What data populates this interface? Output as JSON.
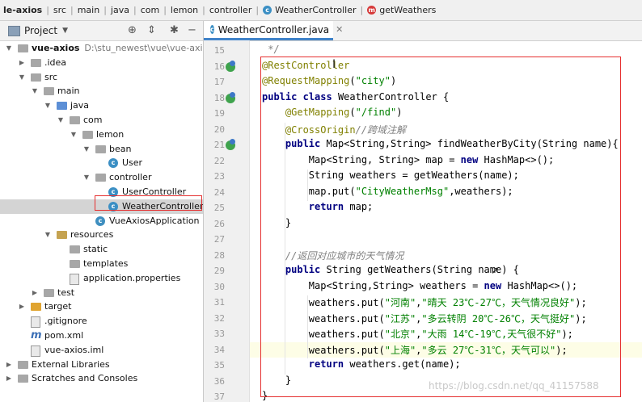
{
  "breadcrumb": [
    {
      "label": "le-axios",
      "icon": ""
    },
    {
      "label": "src",
      "icon": ""
    },
    {
      "label": "main",
      "icon": ""
    },
    {
      "label": "java",
      "icon": ""
    },
    {
      "label": "com",
      "icon": ""
    },
    {
      "label": "lemon",
      "icon": ""
    },
    {
      "label": "controller",
      "icon": ""
    },
    {
      "label": "WeatherController",
      "icon": "class-icon"
    },
    {
      "label": "getWeathers",
      "icon": "method-icon"
    }
  ],
  "project_panel": {
    "title": "Project",
    "tree": [
      {
        "label": "vue-axios",
        "extra": "D:\\stu_newest\\vue\\vue-axios",
        "depth": 0,
        "expanded": true,
        "icon": "module-folder-icon"
      },
      {
        "label": ".idea",
        "depth": 1,
        "expanded": false,
        "icon": "folder-icon"
      },
      {
        "label": "src",
        "depth": 1,
        "expanded": true,
        "icon": "folder-icon"
      },
      {
        "label": "main",
        "depth": 2,
        "expanded": true,
        "icon": "folder-icon"
      },
      {
        "label": "java",
        "depth": 3,
        "expanded": true,
        "icon": "source-folder-icon"
      },
      {
        "label": "com",
        "depth": 4,
        "expanded": true,
        "icon": "package-icon"
      },
      {
        "label": "lemon",
        "depth": 5,
        "expanded": true,
        "icon": "package-icon"
      },
      {
        "label": "bean",
        "depth": 6,
        "expanded": true,
        "icon": "package-icon"
      },
      {
        "label": "User",
        "depth": 7,
        "icon": "class-icon"
      },
      {
        "label": "controller",
        "depth": 6,
        "expanded": true,
        "icon": "package-icon"
      },
      {
        "label": "UserController",
        "depth": 7,
        "icon": "class-icon"
      },
      {
        "label": "WeatherController",
        "depth": 7,
        "icon": "class-icon",
        "selected": true
      },
      {
        "label": "VueAxiosApplication",
        "depth": 6,
        "icon": "spring-class-icon"
      },
      {
        "label": "resources",
        "depth": 3,
        "expanded": true,
        "icon": "resources-folder-icon"
      },
      {
        "label": "static",
        "depth": 4,
        "icon": "folder-icon"
      },
      {
        "label": "templates",
        "depth": 4,
        "icon": "folder-icon"
      },
      {
        "label": "application.properties",
        "depth": 4,
        "icon": "properties-file-icon"
      },
      {
        "label": "test",
        "depth": 2,
        "expanded": false,
        "icon": "folder-icon"
      },
      {
        "label": "target",
        "depth": 1,
        "expanded": false,
        "icon": "excluded-folder-icon"
      },
      {
        "label": ".gitignore",
        "depth": 1,
        "icon": "gitignore-file-icon"
      },
      {
        "label": "pom.xml",
        "depth": 1,
        "icon": "maven-file-icon"
      },
      {
        "label": "vue-axios.iml",
        "depth": 1,
        "icon": "iml-file-icon"
      },
      {
        "label": "External Libraries",
        "depth": 0,
        "expanded": false,
        "icon": "libraries-icon"
      },
      {
        "label": "Scratches and Consoles",
        "depth": 0,
        "expanded": false,
        "icon": "scratches-icon"
      }
    ]
  },
  "editor": {
    "tab_label": "WeatherController.java",
    "lines": [
      {
        "n": "15",
        "code": " */",
        "kind": "comment"
      },
      {
        "n": "16",
        "code": "@RestController",
        "kind": "annotation",
        "gutter": "bean"
      },
      {
        "n": "17",
        "code": "@RequestMapping(\"city\")",
        "kind": "annotation"
      },
      {
        "n": "18",
        "code": "public class WeatherController {",
        "kind": "code",
        "gutter": "web"
      },
      {
        "n": "19",
        "code": "    @GetMapping(\"/find\")",
        "kind": "annotation"
      },
      {
        "n": "20",
        "code": "    @CrossOrigin//跨域注解",
        "kind": "annotation"
      },
      {
        "n": "21",
        "code": "    public Map<String,String> findWeatherByCity(String name){",
        "kind": "code",
        "gutter": "web"
      },
      {
        "n": "22",
        "code": "        Map<String, String> map = new HashMap<>();",
        "kind": "code"
      },
      {
        "n": "23",
        "code": "        String weathers = getWeathers(name);",
        "kind": "code"
      },
      {
        "n": "24",
        "code": "        map.put(\"CityWeatherMsg\",weathers);",
        "kind": "code"
      },
      {
        "n": "25",
        "code": "        return map;",
        "kind": "code"
      },
      {
        "n": "26",
        "code": "    }",
        "kind": "code"
      },
      {
        "n": "27",
        "code": "",
        "kind": "code"
      },
      {
        "n": "28",
        "code": "    //返回对应城市的天气情况",
        "kind": "comment"
      },
      {
        "n": "29",
        "code": "    public String getWeathers(String name) {",
        "kind": "code"
      },
      {
        "n": "30",
        "code": "        Map<String,String> weathers = new HashMap<>();",
        "kind": "code"
      },
      {
        "n": "31",
        "code": "        weathers.put(\"河南\",\"晴天 23℃-27℃，天气情况良好\");",
        "kind": "code"
      },
      {
        "n": "32",
        "code": "        weathers.put(\"江苏\",\"多云转阴 20℃-26℃，天气挺好\");",
        "kind": "code"
      },
      {
        "n": "33",
        "code": "        weathers.put(\"北京\",\"大雨 14℃-19℃,天气很不好\");",
        "kind": "code"
      },
      {
        "n": "34",
        "code": "        weathers.put(\"上海\",\"多云 27℃-31℃，天气可以\");",
        "kind": "code",
        "current": true
      },
      {
        "n": "35",
        "code": "        return weathers.get(name);",
        "kind": "code"
      },
      {
        "n": "36",
        "code": "    }",
        "kind": "code"
      },
      {
        "n": "37",
        "code": "}",
        "kind": "code"
      }
    ]
  },
  "watermark": "https://blog.csdn.net/qq_41157588",
  "colors": {
    "annotation": "#808000",
    "keyword": "#000080",
    "string": "#008000",
    "comment": "#808080",
    "highlight_box": "#e53030"
  }
}
